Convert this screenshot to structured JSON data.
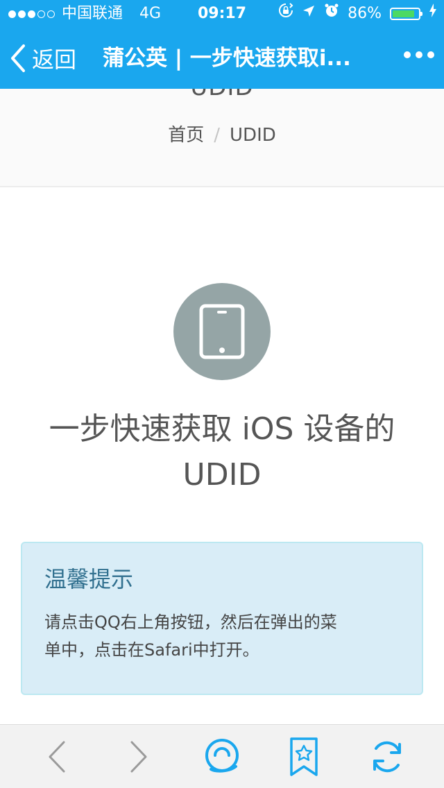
{
  "status_bar": {
    "carrier": "中国联通",
    "network": "4G",
    "time": "09:17",
    "battery_percent": "86%",
    "battery_level": 0.86,
    "signal_strength": 3,
    "signal_max": 5
  },
  "nav": {
    "back_label": "返回",
    "title": "蒲公英 | 一步快速获取i..."
  },
  "page": {
    "clipped_heading": "UDID",
    "breadcrumb": {
      "home": "首页",
      "separator": "/",
      "current": "UDID"
    },
    "device_icon": "tablet-icon",
    "title_line1": "一步快速获取 iOS 设备的",
    "title_line2": "UDID",
    "notice": {
      "title": "温馨提示",
      "text_line1": "请点击QQ右上角按钮，然后在弹出的菜",
      "text_line2": "单中，点击在Safari中打开。"
    }
  },
  "toolbar": {
    "icons": [
      "back-arrow-icon",
      "forward-arrow-icon",
      "qq-share-icon",
      "bookmark-star-icon",
      "refresh-icon"
    ]
  },
  "colors": {
    "nav_bar": "#1aa7ee",
    "device_circle": "#95a5a6",
    "notice_bg": "#d9edf7",
    "notice_border": "#bce8f1",
    "notice_title": "#31708f",
    "toolbar_icon": "#1aa7ee",
    "toolbar_icon_disabled": "#9a9a9a",
    "battery": "#4cd964"
  }
}
